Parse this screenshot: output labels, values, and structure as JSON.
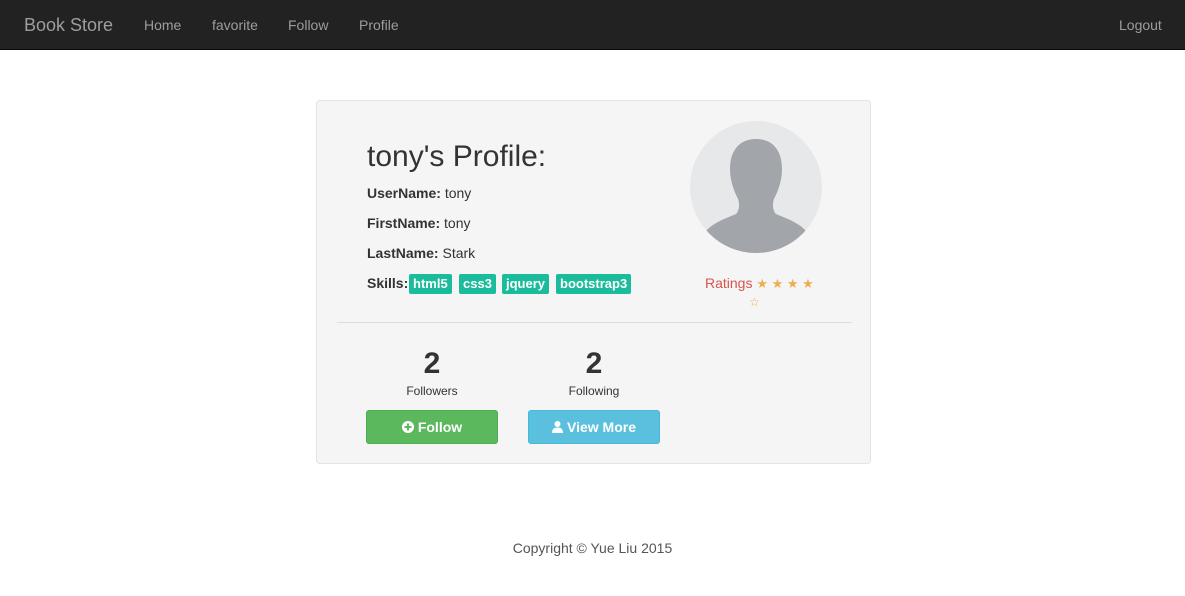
{
  "navbar": {
    "brand": "Book Store",
    "links": [
      "Home",
      "favorite",
      "Follow",
      "Profile"
    ],
    "logout": "Logout"
  },
  "profile": {
    "title": "tony's Profile:",
    "username_label": "UserName:",
    "username": "tony",
    "firstname_label": "FirstName:",
    "firstname": "tony",
    "lastname_label": "LastName:",
    "lastname": "Stark",
    "skills_label": "Skills:",
    "skills": [
      "html5",
      "css3",
      "jquery",
      "bootstrap3"
    ],
    "ratings_label": "Ratings",
    "rating_filled": 4,
    "rating_max": 5,
    "stars_filled_text": "★ ★ ★ ★",
    "star_empty_text": "☆",
    "followers_count": "2",
    "followers_label": "Followers",
    "following_count": "2",
    "following_label": "Following",
    "follow_button": "Follow",
    "view_more_button": "View More",
    "follow_icon": "plus-circle-icon",
    "view_more_icon": "user-icon",
    "avatar_icon": "person-silhouette-icon"
  },
  "footer": {
    "copyright": "Copyright © Yue Liu 2015"
  },
  "colors": {
    "navbar_bg": "#222222",
    "card_bg": "#f5f5f5",
    "skill_tag": "#1abc9c",
    "follow_btn": "#5cb85c",
    "view_more_btn": "#5bc0de",
    "ratings_text": "#d9534f",
    "star": "#f0ad4e"
  }
}
